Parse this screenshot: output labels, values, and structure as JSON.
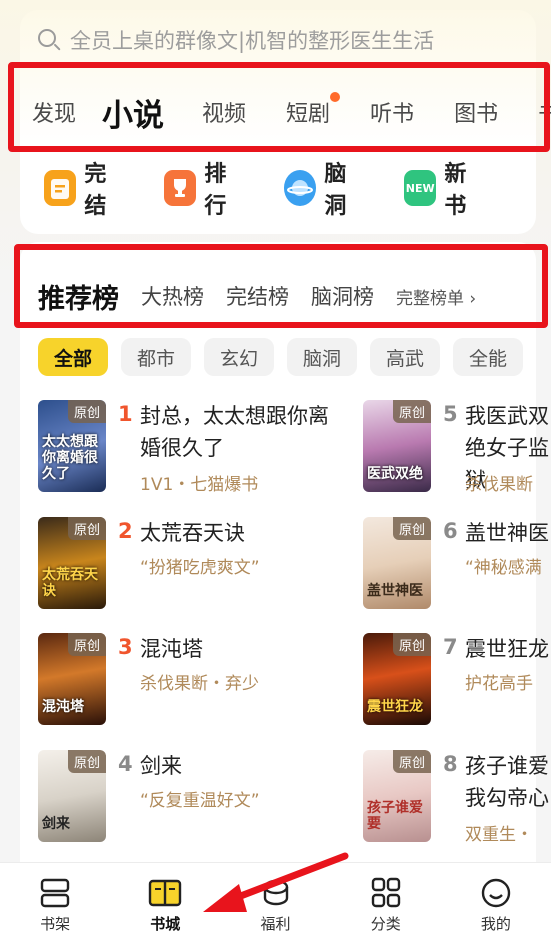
{
  "search": {
    "placeholder": "全员上桌的群像文|机智的整形医生生活"
  },
  "tabs": [
    {
      "label": "发现"
    },
    {
      "label": "小说"
    },
    {
      "label": "视频"
    },
    {
      "label": "短剧"
    },
    {
      "label": "听书"
    },
    {
      "label": "图书"
    },
    {
      "label": "书"
    }
  ],
  "quick": [
    {
      "label": "完结",
      "icon": "clipboard-icon",
      "color": "#f7a21b"
    },
    {
      "label": "排行",
      "icon": "trophy-icon",
      "color": "#f6743a"
    },
    {
      "label": "脑洞",
      "icon": "planet-icon",
      "color": "#3aa0f0"
    },
    {
      "label": "新书",
      "icon": "new-badge-icon",
      "color": "#2fc47f",
      "icon_text": "NEW"
    }
  ],
  "rank_tabs": {
    "items": [
      "推荐榜",
      "大热榜",
      "完结榜",
      "脑洞榜"
    ],
    "more": "完整榜单 ›"
  },
  "filters": [
    "全部",
    "都市",
    "玄幻",
    "脑洞",
    "高武",
    "全能"
  ],
  "books": [
    {
      "rank": "1",
      "title": "封总，太太想跟你离婚很久了",
      "sub": "1V1・七猫爆书",
      "tag": "原创",
      "cover_text": "太太想跟你离婚很久了",
      "rank_color": "#f0552d"
    },
    {
      "rank": "2",
      "title": "太荒吞天诀",
      "sub": "“扮猪吃虎爽文”",
      "tag": "原创",
      "cover_text": "太荒吞天诀",
      "rank_color": "#f0552d"
    },
    {
      "rank": "3",
      "title": "混沌塔",
      "sub": "杀伐果断・弃少",
      "tag": "原创",
      "cover_text": "混沌塔",
      "rank_color": "#f0552d"
    },
    {
      "rank": "4",
      "title": "剑来",
      "sub": "“反复重温好文”",
      "tag": "原创",
      "cover_text": "剑来",
      "rank_color": "#8a8a8a"
    },
    {
      "rank": "5",
      "title": "我医武双绝女子监狱",
      "sub": "杀伐果断",
      "tag": "原创",
      "cover_text": "医武双绝",
      "rank_color": "#8a8a8a"
    },
    {
      "rank": "6",
      "title": "盖世神医",
      "sub": "“神秘感满",
      "tag": "原创",
      "cover_text": "盖世神医",
      "rank_color": "#8a8a8a"
    },
    {
      "rank": "7",
      "title": "震世狂龙",
      "sub": "护花高手",
      "tag": "原创",
      "cover_text": "震世狂龙",
      "rank_color": "#8a8a8a"
    },
    {
      "rank": "8",
      "title": "孩子谁爱我勾帝心",
      "sub": "双重生・",
      "tag": "原创",
      "cover_text": "孩子谁爱要",
      "rank_color": "#8a8a8a"
    }
  ],
  "nav": [
    {
      "label": "书架",
      "icon": "bookshelf-icon"
    },
    {
      "label": "书城",
      "icon": "book-open-icon"
    },
    {
      "label": "福利",
      "icon": "coin-icon"
    },
    {
      "label": "分类",
      "icon": "grid-icon"
    },
    {
      "label": "我的",
      "icon": "profile-icon"
    }
  ]
}
